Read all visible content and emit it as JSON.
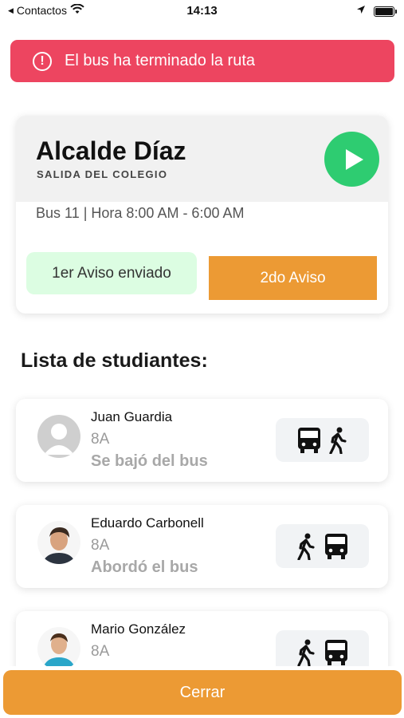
{
  "status_bar": {
    "back_label": "Contactos",
    "time": "14:13"
  },
  "alert": {
    "message": "El bus ha terminado la ruta"
  },
  "route": {
    "title": "Alcalde Díaz",
    "subtitle": "SALIDA DEL COLEGIO",
    "info": "Bus 11 | Hora 8:00 AM - 6:00 AM",
    "first_notice": "1er Aviso enviado",
    "second_notice": "2do Aviso"
  },
  "students_title": "Lista de studiantes:",
  "students": [
    {
      "name": "Juan Guardia",
      "grade": "8A",
      "status": "Se bajó del bus",
      "avatar": "placeholder-avatar",
      "icons": [
        "bus-icon",
        "walk-icon"
      ]
    },
    {
      "name": "Eduardo Carbonell",
      "grade": "8A",
      "status": "Abordó el bus",
      "avatar": "photo-avatar",
      "icons": [
        "walk-icon",
        "bus-icon"
      ]
    },
    {
      "name": "Mario González",
      "grade": "8A",
      "status": "",
      "avatar": "photo-avatar",
      "icons": [
        "walk-icon",
        "bus-icon"
      ]
    }
  ],
  "close_button": "Cerrar",
  "colors": {
    "alert": "#ed4560",
    "accent_orange": "#ec9a34",
    "play_green": "#2ecc71",
    "sent_green_bg": "#dcfde2"
  }
}
